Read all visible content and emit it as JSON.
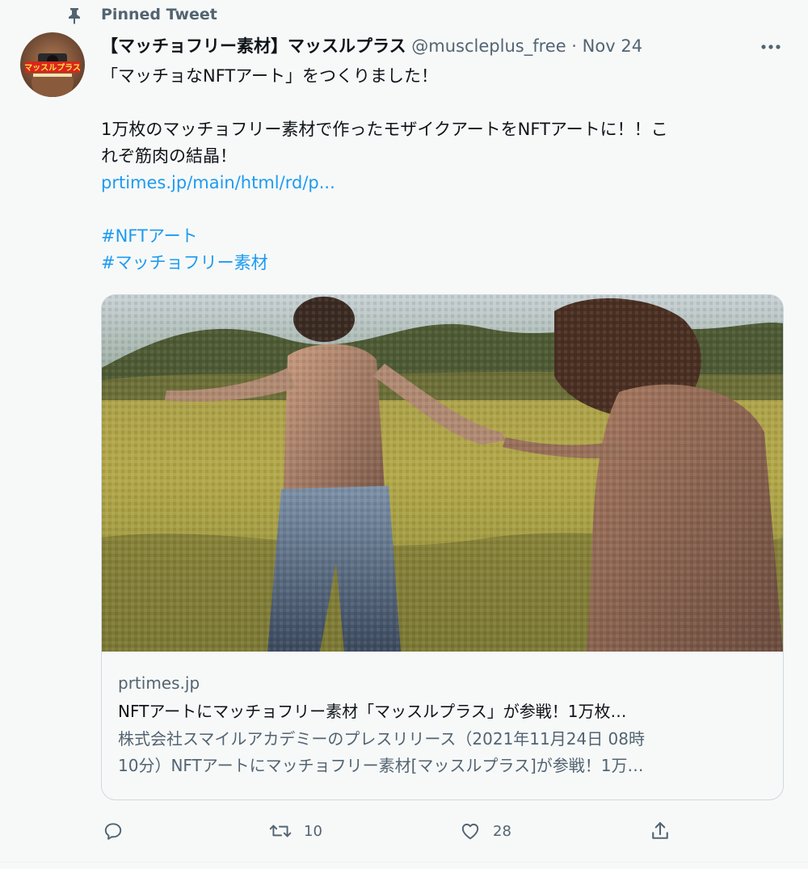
{
  "pinned": {
    "label": "Pinned Tweet"
  },
  "tweet": {
    "display_name": "【マッチョフリー素材】マッスルプラス",
    "handle": "@muscleplus_free",
    "separator": "·",
    "date": "Nov 24",
    "text": {
      "line1": "「マッチョなNFTアート」をつくりました！",
      "line2": "1万枚のマッチョフリー素材で作ったモザイクアートをNFTアートに！！こ",
      "line3": "れぞ筋肉の結晶！",
      "link": "prtimes.jp/main/html/rd/p...",
      "hashtag1": "#NFTアート",
      "hashtag2": "#マッチョフリー素材"
    },
    "avatar_text": "マッスルプラス"
  },
  "card": {
    "domain": "prtimes.jp",
    "title": "NFTアートにマッチョフリー素材「マッスルプラス」が参戦！1万枚…",
    "desc_line1": "株式会社スマイルアカデミーのプレスリリース（2021年11月24日 08時",
    "desc_line2": "10分）NFTアートにマッチョフリー素材[マッスルプラス]が参戦！1万…"
  },
  "actions": {
    "reply_count": "",
    "retweet_count": "10",
    "like_count": "28"
  },
  "colors": {
    "link": "#1d9bf0",
    "secondary_text": "#536471",
    "primary_text": "#0f1419",
    "background": "#f7f9f9"
  },
  "icons": [
    "pin-icon",
    "more-icon",
    "reply-icon",
    "retweet-icon",
    "like-icon",
    "share-icon"
  ]
}
